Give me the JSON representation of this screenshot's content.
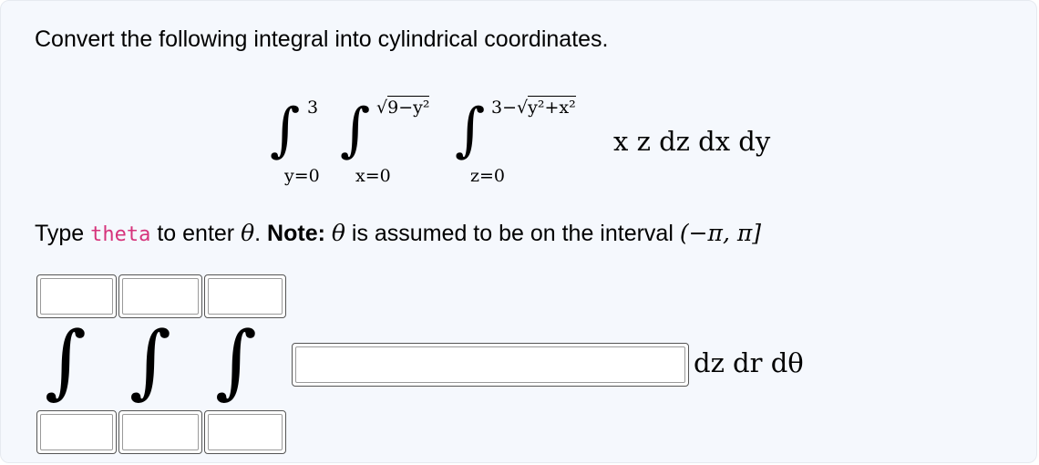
{
  "question": {
    "prompt": "Convert the following integral into cylindrical coordinates."
  },
  "given_integral": {
    "outer": {
      "lower": "y=0",
      "upper": "3"
    },
    "middle": {
      "lower": "x=0",
      "upper_prefix": "√",
      "upper_radicand": "9−y²"
    },
    "inner": {
      "lower": "z=0",
      "upper_prefix": "3−√",
      "upper_radicand": "y²+x²"
    },
    "integrand": "x z dz dx dy"
  },
  "instruction": {
    "type_word": "Type",
    "code_word": "theta",
    "to_enter": "to enter",
    "theta_symbol": "θ",
    "period": ".",
    "note_label": "Note:",
    "note_text": "is assumed to be on the interval",
    "interval": "(−π, π]"
  },
  "answer_form": {
    "integral_sign": "∫",
    "suffix": "dz dr dθ",
    "upper_limits": [
      "",
      "",
      ""
    ],
    "lower_limits": [
      "",
      "",
      ""
    ],
    "integrand_value": ""
  }
}
